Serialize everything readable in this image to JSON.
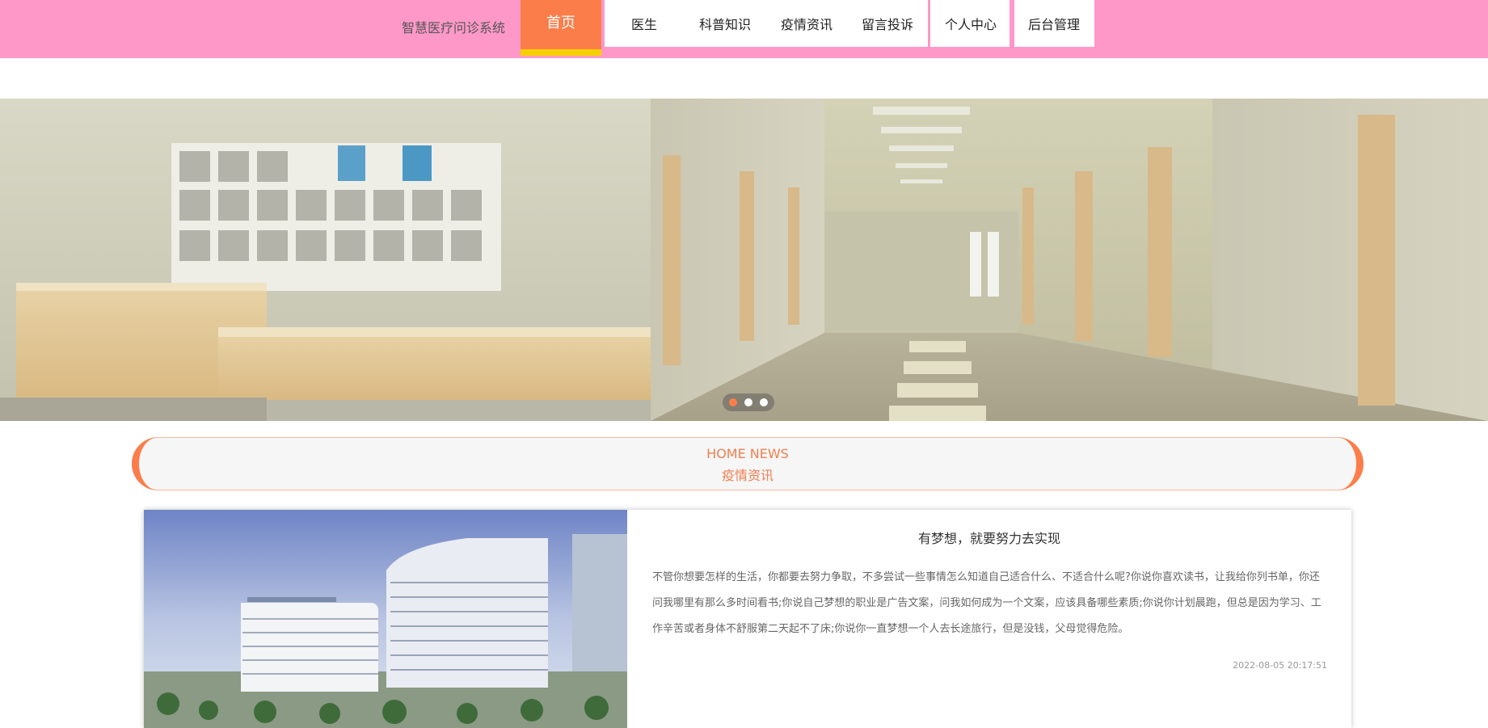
{
  "site": {
    "title": "智慧医疗问诊系统"
  },
  "nav": {
    "items": [
      "首页",
      "医生",
      "科普知识",
      "疫情资讯",
      "留言投诉",
      "个人中心",
      "后台管理"
    ],
    "active": "首页"
  },
  "banner": {
    "slide_count": 3,
    "active_slide": 1
  },
  "section": {
    "title_en": "HOME NEWS",
    "title_cn": "疫情资讯"
  },
  "news": {
    "title": "有梦想，就要努力去实现",
    "body": "不管你想要怎样的生活，你都要去努力争取，不多尝试一些事情怎么知道自己适合什么、不适合什么呢?你说你喜欢读书，让我给你列书单，你还问我哪里有那么多时间看书;你说自己梦想的职业是广告文案，问我如何成为一个文案，应该具备哪些素质;你说你计划晨跑，但总是因为学习、工作辛苦或者身体不舒服第二天起不了床;你说你一直梦想一个人去长途旅行，但是没钱，父母觉得危险。",
    "date": "2022-08-05 20:17:51"
  },
  "colors": {
    "nav_bg": "#fd98c8",
    "accent": "#fb7e4a",
    "active_underline": "#f5d000"
  }
}
